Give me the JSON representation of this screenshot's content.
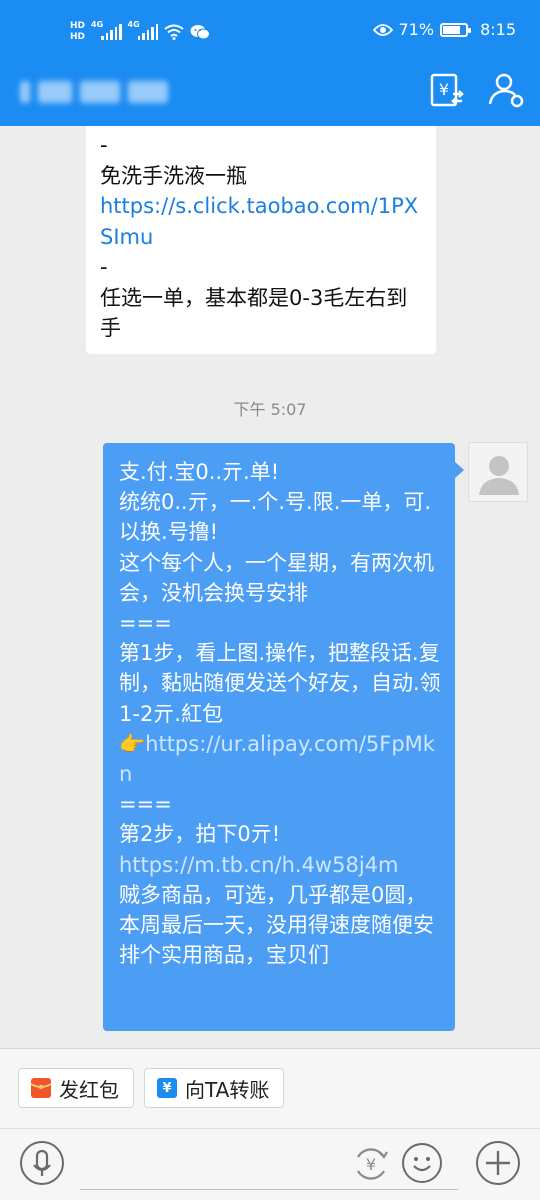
{
  "status_bar": {
    "hd1": "HD",
    "hd2": "HD",
    "net1": "4G",
    "net2": "4G",
    "battery_percent_text": "71%",
    "battery_level": 0.71,
    "time": "8:15"
  },
  "header": {
    "contact_name_hidden": true
  },
  "messages": {
    "incoming": {
      "dash1": "-",
      "line1": "免洗手洗液一瓶",
      "link1": "https://s.click.taobao.com/1PXSImu",
      "dash2": "-",
      "line2": "任选一单，基本都是0-3毛左右到手"
    },
    "timestamp": "下午 5:07",
    "outgoing": {
      "p1": "支.付.宝0..亓.单!",
      "p2": "统统0..亓，一.个.号.限.一单，可.以换.号撸!",
      "p3": "这个每个人，一个星期，有两次机会，没机会换号安排",
      "sep1": "===",
      "p4": "第1步，看上图.操作，把整段话.复制，黏贴随便发送个好友，自动.领1-2亓.紅包",
      "pointer": "👉",
      "link1": "https://ur.alipay.com/5FpMkn",
      "sep2": "===",
      "p5": "第2步，拍下0亓!",
      "link2": "https://m.tb.cn/h.4w58j4m",
      "p6": "贼多商品，可选，几乎都是0圆，本周最后一天，没用得速度随便安排个实用商品，宝贝们"
    }
  },
  "quick_actions": {
    "red_packet": "发红包",
    "transfer": "向TA转账"
  },
  "colors": {
    "header": "#1b8cf2",
    "outgoing_bubble": "#4b9ef3",
    "link_in": "#1a7fe0",
    "red_packet": "#f0552c",
    "transfer": "#1b8cf2"
  },
  "icons": [
    "wifi-icon",
    "wechat-icon",
    "eye-icon",
    "battery-icon",
    "yuan-transfer-icon",
    "contact-icon",
    "avatar-placeholder-icon",
    "voice-icon",
    "yuan-circle-icon",
    "emoji-icon",
    "plus-icon"
  ]
}
